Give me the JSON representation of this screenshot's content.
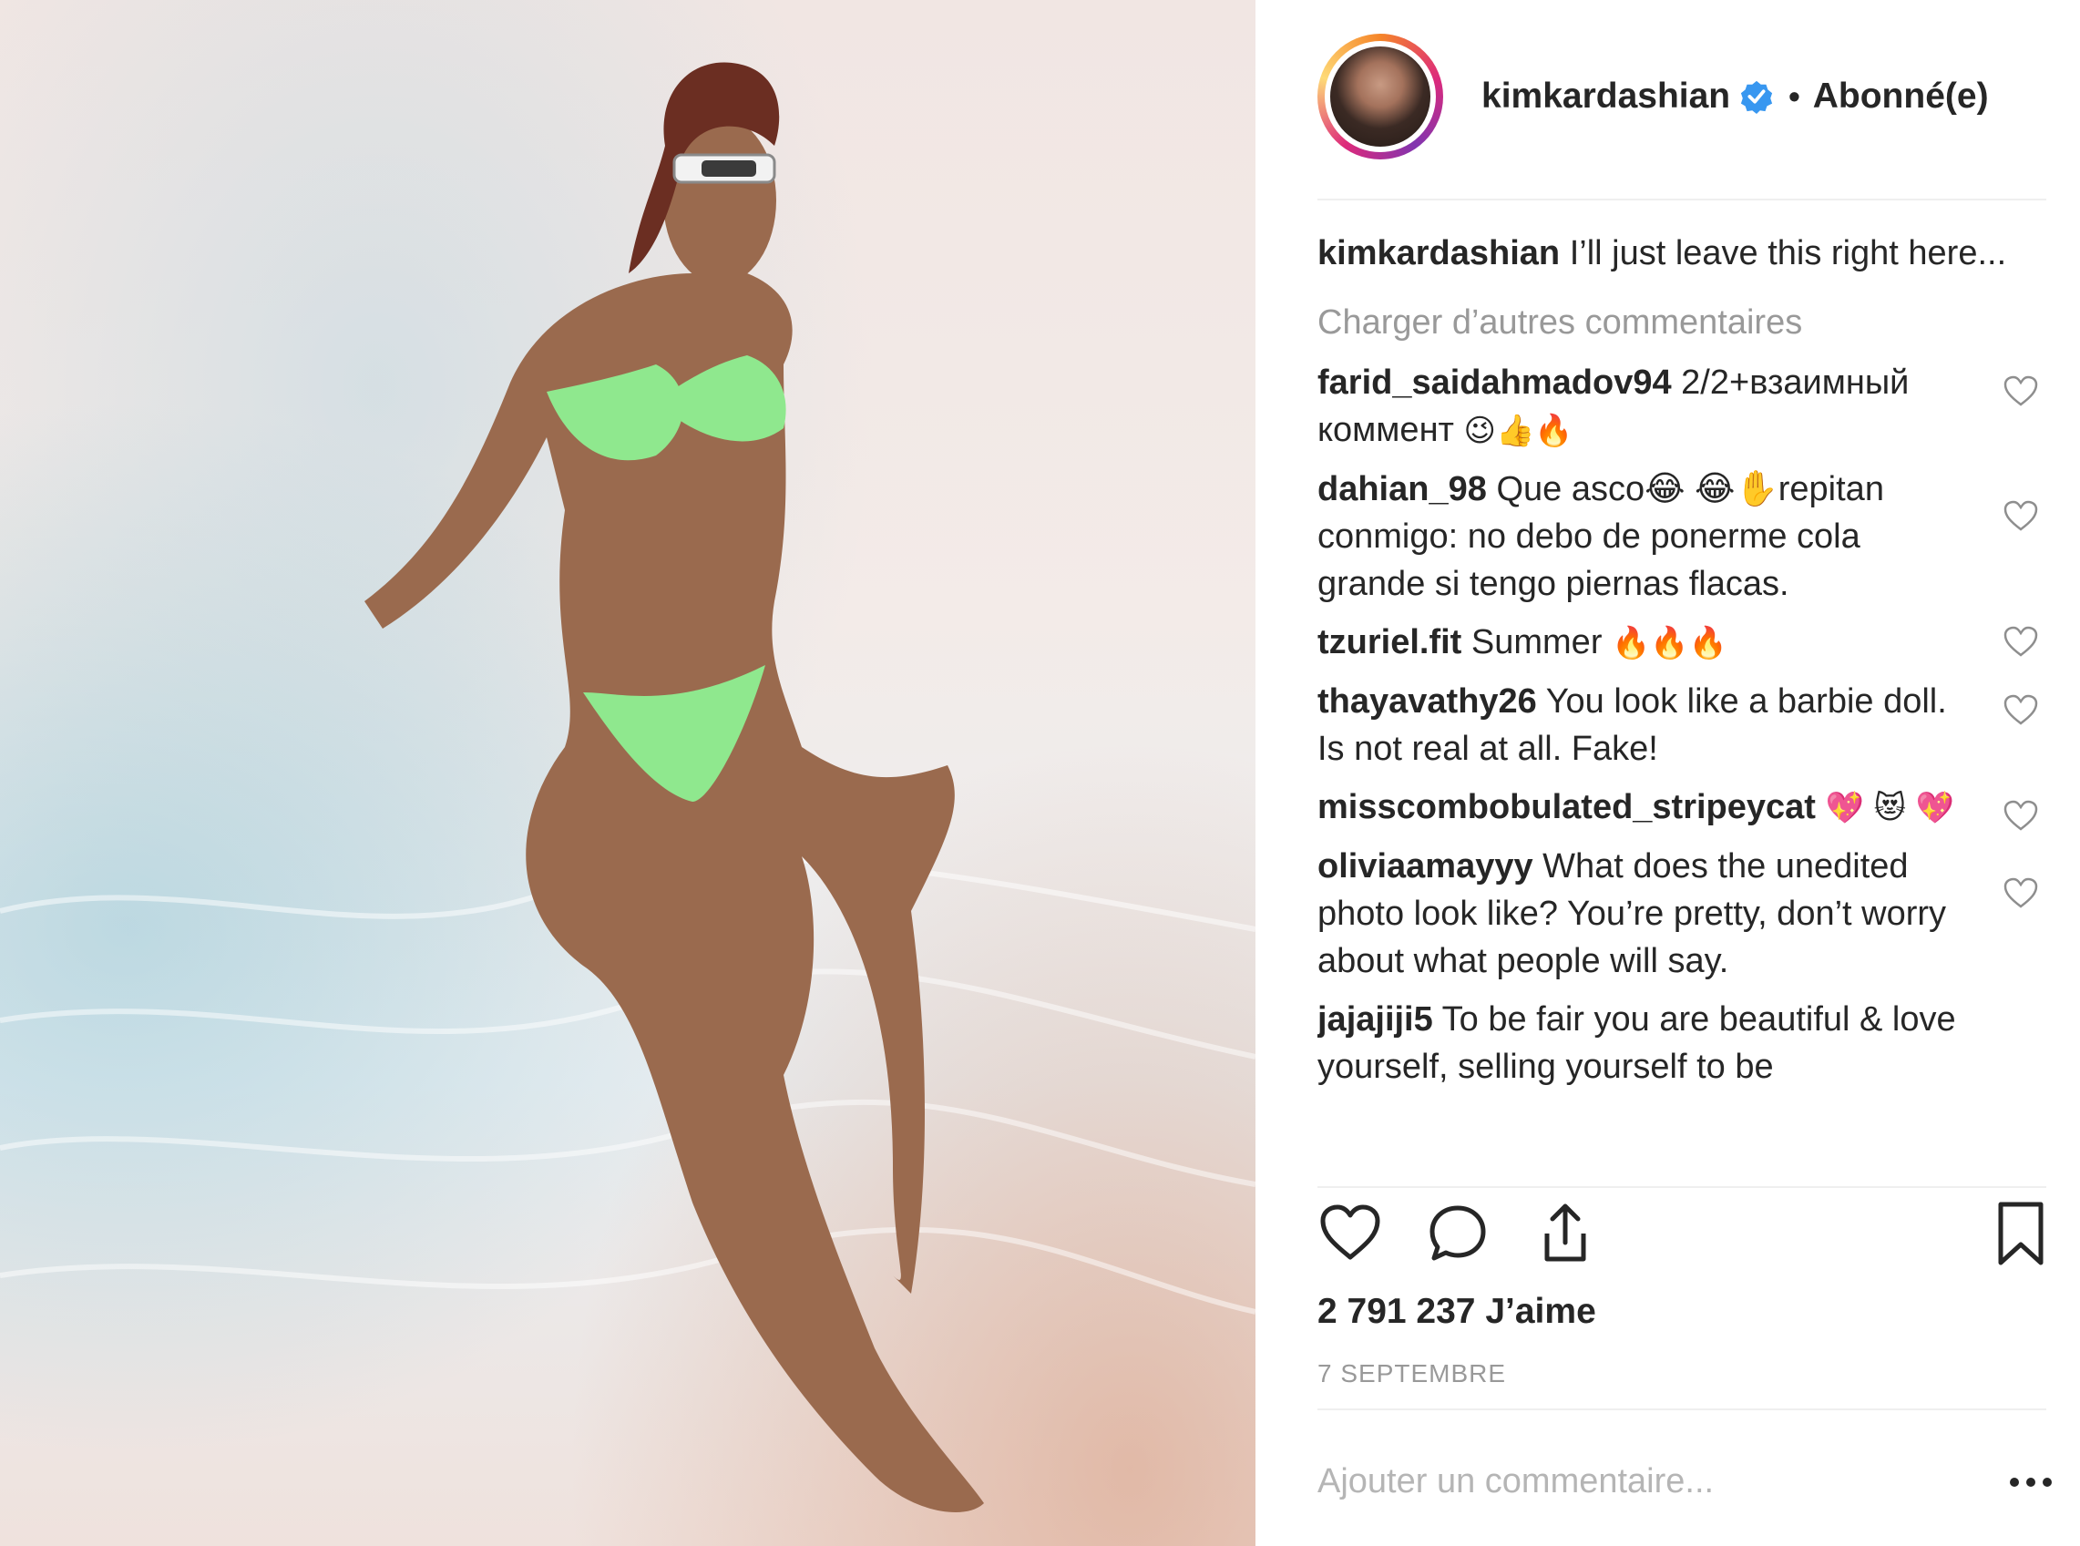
{
  "photo": {
    "alt_name": "beach-photo"
  },
  "header": {
    "username": "kimkardashian",
    "separator": "•",
    "follow_status": "Abonné(e)"
  },
  "caption": {
    "username": "kimkardashian",
    "text": "I’ll just leave this right here..."
  },
  "load_more": "Charger d’autres commentaires",
  "comments": [
    {
      "user": "farid_saidahmadov94",
      "text": "2/2+взаимный коммент",
      "emoji": "😉👍🔥"
    },
    {
      "user": "dahian_98",
      "text": "Que asco😂 😂✋repitan conmigo: no debo de ponerme cola grande si tengo piernas flacas.",
      "emoji": ""
    },
    {
      "user": "tzuriel.fit",
      "text": "Summer",
      "emoji": "🔥🔥🔥"
    },
    {
      "user": "thayavathy26",
      "text": "You look like a barbie doll. Is not real at all. Fake!",
      "emoji": ""
    },
    {
      "user": "misscombobulated_stripeycat",
      "text": "",
      "emoji": "💖 😻 💖"
    },
    {
      "user": "oliviaamayyy",
      "text": "What does the unedited photo look like? You’re pretty, don’t worry about what people will say.",
      "emoji": ""
    },
    {
      "user": "jajajiji5",
      "text": "To be fair you are beautiful & love yourself, selling yourself to be",
      "emoji": ""
    }
  ],
  "likes": "2 791 237 J’aime",
  "date": "7 SEPTEMBRE",
  "add_comment_placeholder": "Ajouter un commentaire...",
  "colors": {
    "text": "#262626",
    "muted": "#999999",
    "verified": "#3897f0",
    "border": "#efefef"
  }
}
